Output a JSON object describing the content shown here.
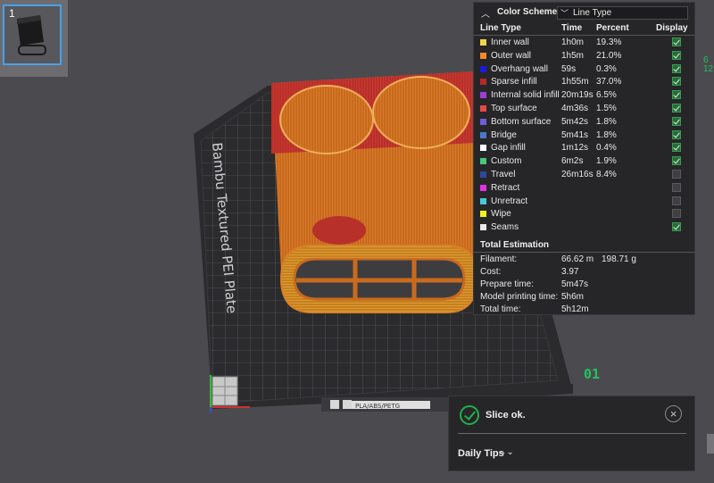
{
  "plate": {
    "thumbnail_number": "1",
    "label": "Bambu Textured PEI Plate",
    "badge_text": "PLA/ABS/PETG",
    "plate_number": "01"
  },
  "edge_indicator": {
    "top": "6",
    "bottom": "12"
  },
  "color_scheme": {
    "title": "Color Scheme",
    "selected": "Line Type",
    "columns": {
      "line_type": "Line Type",
      "time": "Time",
      "percent": "Percent",
      "display": "Display"
    },
    "rows": [
      {
        "name": "Inner wall",
        "time": "1h0m",
        "percent": "19.3%",
        "color": "#f0d44c",
        "display": true
      },
      {
        "name": "Outer wall",
        "time": "1h5m",
        "percent": "21.0%",
        "color": "#ef8a2e",
        "display": true
      },
      {
        "name": "Overhang wall",
        "time": "59s",
        "percent": "0.3%",
        "color": "#1b1bd6",
        "display": true
      },
      {
        "name": "Sparse infill",
        "time": "1h55m",
        "percent": "37.0%",
        "color": "#b22a2a",
        "display": true
      },
      {
        "name": "Internal solid infill",
        "time": "20m19s",
        "percent": "6.5%",
        "color": "#9a3fd0",
        "display": true
      },
      {
        "name": "Top surface",
        "time": "4m36s",
        "percent": "1.5%",
        "color": "#e84848",
        "display": true
      },
      {
        "name": "Bottom surface",
        "time": "5m42s",
        "percent": "1.8%",
        "color": "#6e5dd6",
        "display": true
      },
      {
        "name": "Bridge",
        "time": "5m41s",
        "percent": "1.8%",
        "color": "#4d78c8",
        "display": true
      },
      {
        "name": "Gap infill",
        "time": "1m12s",
        "percent": "0.4%",
        "color": "#ffffff",
        "display": true
      },
      {
        "name": "Custom",
        "time": "6m2s",
        "percent": "1.9%",
        "color": "#4bc47e",
        "display": true
      },
      {
        "name": "Travel",
        "time": "26m16s",
        "percent": "8.4%",
        "color": "#2c4a9a",
        "display": false
      },
      {
        "name": "Retract",
        "time": "",
        "percent": "",
        "color": "#e034e0",
        "display": false
      },
      {
        "name": "Unretract",
        "time": "",
        "percent": "",
        "color": "#4ac8d8",
        "display": false
      },
      {
        "name": "Wipe",
        "time": "",
        "percent": "",
        "color": "#f0f028",
        "display": false
      },
      {
        "name": "Seams",
        "time": "",
        "percent": "",
        "color": "#e8e8e8",
        "display": true
      }
    ]
  },
  "total_estimation": {
    "title": "Total Estimation",
    "filament_label": "Filament:",
    "filament_length": "66.62 m",
    "filament_weight": "198.71 g",
    "cost_label": "Cost:",
    "cost": "3.97",
    "prepare_label": "Prepare time:",
    "prepare": "5m47s",
    "model_label": "Model printing time:",
    "model": "5h6m",
    "total_label": "Total time:",
    "total": "5h12m"
  },
  "notification": {
    "message": "Slice ok.",
    "close": "×",
    "tips": "Daily Tips",
    "tips_icon": "double-chevron-down-icon"
  }
}
